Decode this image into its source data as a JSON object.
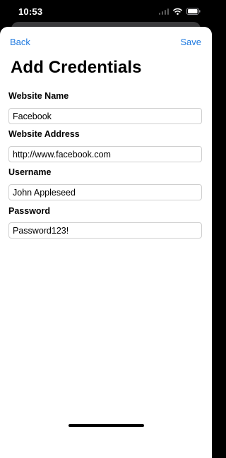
{
  "status_bar": {
    "time": "10:53"
  },
  "nav": {
    "back_label": "Back",
    "save_label": "Save"
  },
  "title": "Add Credentials",
  "fields": [
    {
      "label": "Website Name",
      "value": "Facebook"
    },
    {
      "label": "Website Address",
      "value": "http://www.facebook.com"
    },
    {
      "label": "Username",
      "value": "John Appleseed"
    },
    {
      "label": "Password",
      "value": "Password123!"
    }
  ],
  "colors": {
    "accent": "#1f7ae0",
    "background": "#000000",
    "sheet": "#ffffff",
    "input_border": "#cfcfcf"
  },
  "icons": [
    "signal-icon",
    "wifi-icon",
    "battery-icon"
  ]
}
